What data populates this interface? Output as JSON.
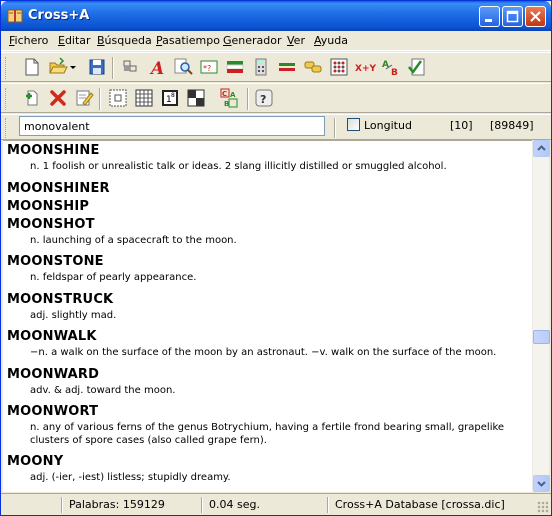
{
  "window": {
    "title": "Cross+A"
  },
  "menu": [
    "Fichero",
    "Editar",
    "Búsqueda",
    "Pasatiempo",
    "Generador",
    "Ver",
    "Ayuda"
  ],
  "menu_underline": [
    "F",
    "E",
    "B",
    "P",
    "G",
    "V",
    "A"
  ],
  "search": {
    "value": "monovalent",
    "longitud_label": "Longitud",
    "length": "[10]",
    "count": "[89849]"
  },
  "entries": [
    {
      "word": "MOONSHINE",
      "def": "n. 1 foolish or unrealistic talk or ideas. 2 slang illicitly distilled or smuggled alcohol."
    },
    {
      "word": "MOONSHINER",
      "def": ""
    },
    {
      "word": "MOONSHIP",
      "def": ""
    },
    {
      "word": "MOONSHOT",
      "def": "n. launching of a spacecraft to the moon."
    },
    {
      "word": "MOONSTONE",
      "def": "n. feldspar of pearly appearance."
    },
    {
      "word": "MOONSTRUCK",
      "def": "adj. slightly mad."
    },
    {
      "word": "MOONWALK",
      "def": "−n. a walk on the surface of the moon by an astronaut. −v. walk on the surface of the moon."
    },
    {
      "word": "MOONWARD",
      "def": "adv. & adj. toward the moon."
    },
    {
      "word": "MOONWORT",
      "def": "n. any of various ferns of the genus Botrychium, having a fertile frond bearing small, grapelike clusters of spore cases (also called grape fern)."
    },
    {
      "word": "MOONY",
      "def": "adj. (-ier, -iest) listless; stupidly dreamy."
    }
  ],
  "status": {
    "palabras": "Palabras: 159129",
    "time": "0.04 seg.",
    "database": "Cross+A Database [crossa.dic]"
  },
  "icons": {
    "toolbar1": [
      "new-icon",
      "open-icon",
      "dropdown-icon",
      "save-icon",
      "grid-icon",
      "font-a-icon",
      "find-icon",
      "wildcard-icon",
      "flag-icon",
      "calculator-icon",
      "equals-icon",
      "chain-icon",
      "dice-grid-icon",
      "xy-icon",
      "ab-icon",
      "checklist-icon"
    ],
    "toolbar2": [
      "add-icon",
      "delete-icon",
      "edit-icon",
      "grid-dots-icon",
      "grid-lines-icon",
      "numbered-grid-icon",
      "checker-icon",
      "abc-icon",
      "help-icon"
    ]
  },
  "colors": {
    "title_bar": "#0b52d0",
    "window_bg": "#ece9d8",
    "border": "#0831d9"
  }
}
